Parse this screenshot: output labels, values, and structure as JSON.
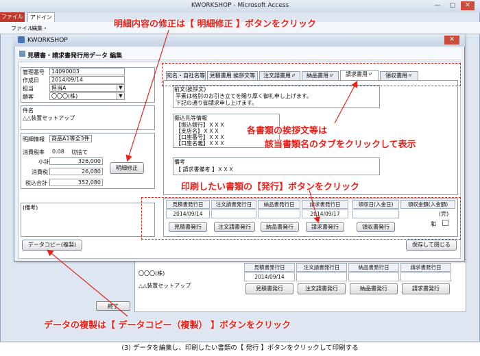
{
  "app": {
    "window_title": "KWORKSHOP - Microsoft Access",
    "ribbon_tabs": [
      "ファイル",
      "アドイン"
    ],
    "menu": [
      "ファイル・",
      "編集・"
    ],
    "controls": {
      "minimize": "—",
      "maximize": "□",
      "close": "✕"
    }
  },
  "dialog": {
    "title": "KWORKSHOP",
    "subtitle": "見積書・請求書発行用データ 編集",
    "close": "✕",
    "info": {
      "rows": [
        {
          "label": "管理番号",
          "value": "14090003"
        },
        {
          "label": "作成日",
          "value": "2014/09/14"
        },
        {
          "label": "担当",
          "value": "担当A"
        },
        {
          "label": "顧客",
          "value": "〇〇〇(株)"
        }
      ]
    },
    "subject": {
      "label": "件名",
      "value": "△△装置セットアップ"
    },
    "detail": {
      "label": "明細情報",
      "value": "商品A1等全3件"
    },
    "tax": {
      "label": "消費税率",
      "rate": "0.08",
      "mode": "切捨て"
    },
    "totals": [
      {
        "label": "小計",
        "value": "326,000"
      },
      {
        "label": "消費税",
        "value": "26,080"
      },
      {
        "label": "税込合計",
        "value": "352,080"
      }
    ],
    "detail_edit_button": "明細修正",
    "remarks_label": "(備考)",
    "tabs": [
      {
        "label": "宛名・自社名等",
        "active": false
      },
      {
        "label": "見積書用 挨拶文等",
        "active": false
      },
      {
        "label": "注文請書用〃",
        "active": false
      },
      {
        "label": "納品書用〃",
        "active": false
      },
      {
        "label": "請求書用〃",
        "active": true
      },
      {
        "label": "領収書用〃",
        "active": false
      }
    ],
    "preface": {
      "label": "前文(挨拶文)",
      "lines": [
        "平素は格別のお引き立てを賜り厚く御礼申し上げます。",
        "下記の通り御請求申し上げます。"
      ]
    },
    "transfer": {
      "label": "振込先等情報",
      "lines": [
        "【振込銀行】ＸＸＸ",
        "【支店名】ＸＸＸ",
        "【口座番号】ＸＸＸ",
        "【口座名義】ＸＸＸ"
      ]
    },
    "notes": {
      "label": "備考",
      "value": "【 請求書備考 】ＸＸＸ"
    },
    "issue_columns": [
      {
        "header": "見積書発行日",
        "date": "2014/09/14",
        "button": "見積書発行"
      },
      {
        "header": "注文請書発行日",
        "date": "",
        "button": "注文請書発行"
      },
      {
        "header": "納品書発行日",
        "date": "",
        "button": "納品書発行"
      },
      {
        "header": "請求書発行日",
        "date": "2014/09/17",
        "button": "請求書発行"
      },
      {
        "header": "領収日(入金日)",
        "date": "",
        "button": "領収書発行"
      }
    ],
    "receipt_amount": {
      "header": "領収金額(入金額)",
      "label1": "(完)",
      "label2": "和"
    },
    "copy_button": "データコピー(複製)",
    "save_close_button": "保存して閉じる"
  },
  "background_form": {
    "customer": "〇〇〇(株)",
    "subject": "△△装置セットアップ",
    "row_partial": "顧客 / 件名",
    "headers": [
      "見積書発行日",
      "注文請書発行日",
      "納品書発行日",
      "請求書発行日"
    ],
    "dates": [
      "2014/09/14",
      "",
      "",
      ""
    ],
    "buttons": [
      "見積書発行",
      "注文請書発行",
      "納品書発行",
      "請求書発行"
    ],
    "end_button": "終了"
  },
  "annotations": {
    "detail_edit": "明細内容の修正は【 明細修正 】ボタンをクリック",
    "tabs_1": "各書類の挨拶文等は",
    "tabs_2": "該当書類名のタブをクリックして表示",
    "issue": "印刷したい書類の【発行】ボタンをクリック",
    "copy": "データの複製は【 データコピー（複製） 】ボタンをクリック"
  },
  "caption": "(3) データを編集し、印刷したい書類の【 発行 】ボタンをクリックして印刷する",
  "colors": {
    "annotation": "#e8211a",
    "dialog_border": "#6d88ad",
    "close": "#c94c3c"
  }
}
